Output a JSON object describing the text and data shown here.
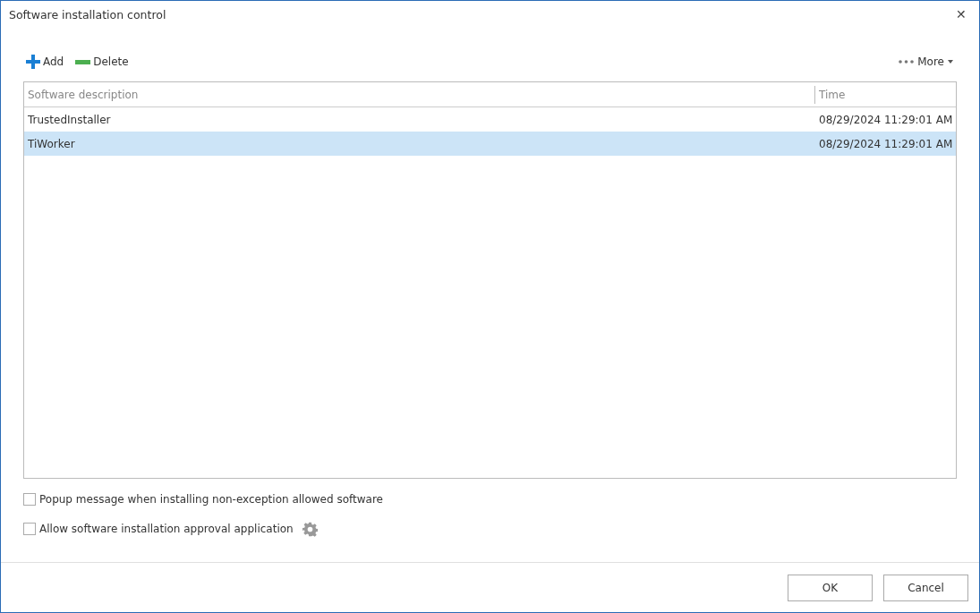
{
  "window": {
    "title": "Software installation control",
    "close": "✕"
  },
  "toolbar": {
    "add": "Add",
    "delete": "Delete",
    "more": "More"
  },
  "table": {
    "columns": [
      "Software description",
      "Time"
    ],
    "rows": [
      {
        "description": "TrustedInstaller",
        "time": "08/29/2024 11:29:01 AM",
        "selected": false
      },
      {
        "description": "TiWorker",
        "time": "08/29/2024 11:29:01 AM",
        "selected": true
      }
    ]
  },
  "options": [
    {
      "label": "Popup message when installing non-exception allowed software",
      "checked": false,
      "settings": false
    },
    {
      "label": "Allow software installation approval application",
      "checked": false,
      "settings": true
    }
  ],
  "buttons": [
    "OK",
    "Cancel"
  ]
}
